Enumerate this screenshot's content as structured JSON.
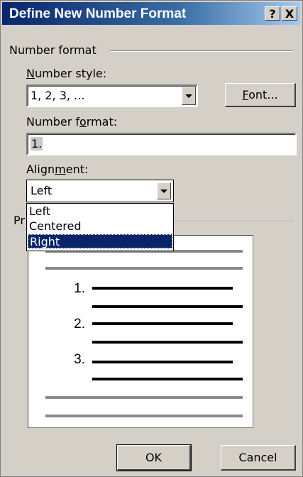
{
  "dialog": {
    "title": "Define New Number Format",
    "help_label": "?",
    "close_label": "X"
  },
  "group": {
    "label": "Number format",
    "preview_label": "Pr"
  },
  "number_style": {
    "label_u": "N",
    "label_rest": "umber style:",
    "value": "1, 2, 3, ..."
  },
  "font_button": {
    "label_u": "F",
    "label_rest": "ont..."
  },
  "number_format": {
    "label_pre": "Number f",
    "label_u": "o",
    "label_post": "rmat:",
    "value": "1."
  },
  "alignment": {
    "label_pre": "Align",
    "label_u": "m",
    "label_post": "ent:",
    "value": "Left",
    "options": [
      "Left",
      "Centered",
      "Right"
    ],
    "highlighted": "Right"
  },
  "preview": {
    "numbers": [
      "1.",
      "2.",
      "3."
    ]
  },
  "buttons": {
    "ok": "OK",
    "cancel": "Cancel"
  },
  "colors": {
    "title_bar": "#0a246a",
    "face": "#d4d0c8",
    "selection": "#0a246a"
  }
}
